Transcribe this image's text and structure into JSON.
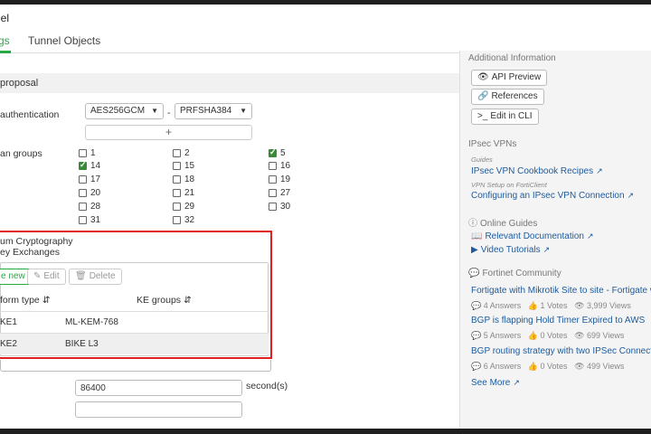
{
  "window": {
    "title": "nel"
  },
  "tabs": [
    {
      "label": "gs",
      "active": true
    },
    {
      "label": "Tunnel Objects",
      "active": false
    }
  ],
  "proposal": {
    "header": "proposal",
    "auth_label": "authentication",
    "encryption": "AES256GCM",
    "separator": "-",
    "hash": "PRFSHA384",
    "add_symbol": "+",
    "dh_label": "an groups",
    "groups": [
      {
        "n": "1",
        "checked": false
      },
      {
        "n": "2",
        "checked": false
      },
      {
        "n": "5",
        "checked": true
      },
      {
        "n": "14",
        "checked": true
      },
      {
        "n": "15",
        "checked": false
      },
      {
        "n": "16",
        "checked": false
      },
      {
        "n": "17",
        "checked": false
      },
      {
        "n": "18",
        "checked": false
      },
      {
        "n": "19",
        "checked": false
      },
      {
        "n": "20",
        "checked": false
      },
      {
        "n": "21",
        "checked": false
      },
      {
        "n": "27",
        "checked": false
      },
      {
        "n": "28",
        "checked": false
      },
      {
        "n": "29",
        "checked": false
      },
      {
        "n": "30",
        "checked": false
      },
      {
        "n": "31",
        "checked": false
      },
      {
        "n": "32",
        "checked": false
      }
    ]
  },
  "pq": {
    "label_line1": "um Cryptography",
    "label_line2": "ey Exchanges",
    "btn_new": "e new",
    "btn_edit": "Edit",
    "btn_delete": "Delete",
    "col1": "form type",
    "col2": "KE groups",
    "rows": [
      {
        "type": "KE1",
        "groups": "ML-KEM-768"
      },
      {
        "type": "KE2",
        "groups": "BIKE L3"
      }
    ]
  },
  "lifetime": {
    "value": "86400",
    "unit": "second(s)"
  },
  "right": {
    "additional_title": "Additional Information",
    "api_preview": "API Preview",
    "references": "References",
    "edit_cli": "Edit in CLI",
    "ipsec_title": "IPsec VPNs",
    "guides_sub": "Guides",
    "cookbook": "IPsec VPN Cookbook Recipes",
    "forticlient_sub": "VPN Setup on FortiClient",
    "configuring": "Configuring an IPsec VPN Connection",
    "online_title": "Online Guides",
    "relevant_docs": "Relevant Documentation",
    "video_tutorials": "Video Tutorials",
    "community_title": "Fortinet Community",
    "posts": [
      {
        "title": "Fortigate with Mikrotik Site to site - Fortigate with",
        "answers": "4 Answers",
        "votes": "1 Votes",
        "views": "3,999 Views"
      },
      {
        "title": "BGP is flapping Hold Timer Expired to AWS",
        "answers": "5 Answers",
        "votes": "0 Votes",
        "views": "699 Views"
      },
      {
        "title": "BGP routing strategy with two IPSec Connections",
        "answers": "6 Answers",
        "votes": "0 Votes",
        "views": "499 Views"
      }
    ],
    "see_more": "See More"
  },
  "colors": {
    "accent": "#28a745",
    "highlight": "#e02020",
    "link": "#1d5b9c"
  }
}
